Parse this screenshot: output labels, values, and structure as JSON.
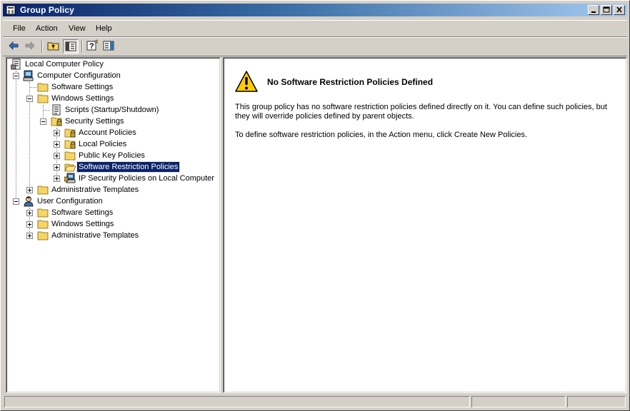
{
  "window": {
    "title": "Group Policy"
  },
  "menu": {
    "items": [
      "File",
      "Action",
      "View",
      "Help"
    ]
  },
  "toolbar": {
    "buttons": [
      "back-icon",
      "forward-icon",
      "up-folder-icon",
      "show-hide-tree-icon",
      "help-icon",
      "show-hide-action-pane-icon"
    ]
  },
  "tree": {
    "root": "Local Computer Policy",
    "computer_configuration": "Computer Configuration",
    "cc_software_settings": "Software Settings",
    "cc_windows_settings": "Windows Settings",
    "scripts": "Scripts (Startup/Shutdown)",
    "security_settings": "Security Settings",
    "account_policies": "Account Policies",
    "local_policies": "Local Policies",
    "public_key_policies": "Public Key Policies",
    "software_restriction_policies": "Software Restriction Policies",
    "ip_security_policies": "IP Security Policies on Local Computer",
    "cc_administrative_templates": "Administrative Templates",
    "user_configuration": "User Configuration",
    "uc_software_settings": "Software Settings",
    "uc_windows_settings": "Windows Settings",
    "uc_administrative_templates": "Administrative Templates",
    "selected": "Software Restriction Policies"
  },
  "details": {
    "icon": "warning-icon",
    "heading": "No Software Restriction Policies Defined",
    "paragraph1": "This group policy has no software restriction policies defined directly on it. You can define such policies, but they will override policies defined by parent objects.",
    "paragraph2": "To define software restriction policies, in the Action menu, click Create New Policies."
  },
  "colors": {
    "titlebar_start": "#0a246a",
    "titlebar_end": "#a6caf0",
    "selection": "#0a246a",
    "chrome": "#d4d0c8",
    "folder": "#f5d565",
    "warning": "#ffcc00"
  }
}
